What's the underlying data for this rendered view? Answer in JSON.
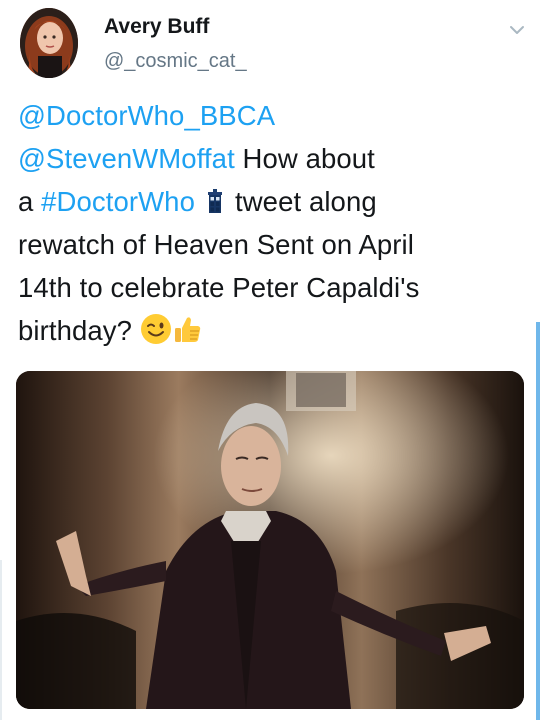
{
  "author": {
    "display_name": "Avery Buff",
    "handle": "@_cosmic_cat_"
  },
  "tweet": {
    "lines": [
      [
        {
          "type": "mention",
          "text": "@DoctorWho_BBCA"
        }
      ],
      [
        {
          "type": "mention",
          "text": "@StevenWMoffat"
        },
        {
          "type": "text",
          "text": " How about"
        }
      ],
      [
        {
          "type": "text",
          "text": "a "
        },
        {
          "type": "hashtag",
          "text": "#DoctorWho"
        },
        {
          "type": "emoji",
          "name": "tardis-emoji"
        },
        {
          "type": "text",
          "text": "tweet along"
        }
      ],
      [
        {
          "type": "text",
          "text": "rewatch of Heaven Sent on April"
        }
      ],
      [
        {
          "type": "text",
          "text": "14th to celebrate Peter Capaldi's"
        }
      ],
      [
        {
          "type": "text",
          "text": "birthday? "
        },
        {
          "type": "emoji",
          "name": "winking-face-emoji"
        },
        {
          "type": "emoji",
          "name": "thumbs-up-emoji"
        }
      ]
    ]
  },
  "icons": {
    "menu": "chevron-down-icon"
  },
  "colors": {
    "link": "#1da1f2",
    "text": "#14171a",
    "secondary": "#657786",
    "scrollbar": "#6fb7ea"
  }
}
